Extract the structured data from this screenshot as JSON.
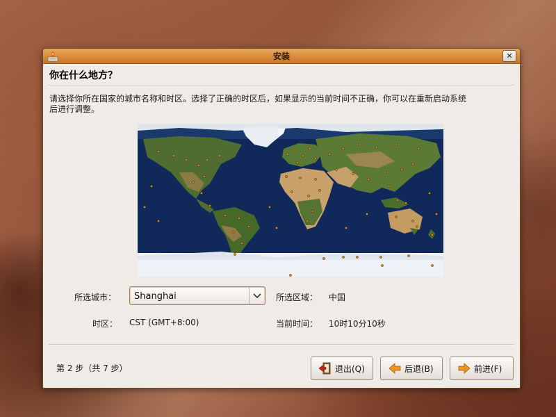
{
  "window": {
    "title": "安装",
    "close_label": "✕"
  },
  "page": {
    "heading": "你在什么地方？",
    "description": "请选择你所在国家的城市名称和时区。选择了正确的时区后，如果显示的当前时间不正确，你可以在重新启动系统后进行调整。"
  },
  "form": {
    "city_label": "所选城市：",
    "city_value": "Shanghai",
    "region_label": "所选区域：",
    "region_value": "中国",
    "tz_label": "时区：",
    "tz_value": "CST (GMT+8:00)",
    "time_label": "当前时间：",
    "time_value": "10时10分10秒"
  },
  "footer": {
    "step": "第 2 步（共 7 步）",
    "quit_label": "退出(Q)",
    "back_label": "后退(B)",
    "forward_label": "前进(F)"
  },
  "icons": {
    "app": "installer-icon",
    "close": "close-icon",
    "combo": "chevron-down-icon",
    "quit": "quit-icon",
    "back": "arrow-left-icon",
    "forward": "arrow-right-icon"
  },
  "colors": {
    "titlebar": "#d98b3a",
    "ocean": "#0f2a55",
    "land": "#4d6b2e",
    "desert": "#c9a36a",
    "ice": "#eef1f5",
    "city_dot": "#e08a17"
  }
}
